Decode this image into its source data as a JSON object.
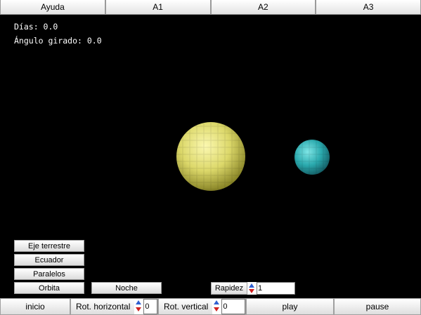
{
  "topbar": {
    "tabs": [
      "Ayuda",
      "A1",
      "A2",
      "A3"
    ]
  },
  "info": {
    "days": "Días: 0.0",
    "angle": "Ángulo girado: 0.0"
  },
  "panel": {
    "eje_label": "Eje terrestre",
    "ecuador_label": "Ecuador",
    "paralelos_label": "Paralelos",
    "orbita_label": "Orbita",
    "noche_label": "Noche"
  },
  "speed": {
    "label": "Rapidez",
    "value": "1"
  },
  "bottombar": {
    "inicio_label": "inicio",
    "rot_h_label": "Rot. horizontal",
    "rot_h_value": "0",
    "rot_v_label": "Rot. vertical",
    "rot_v_value": "0",
    "play_label": "play",
    "pause_label": "pause"
  },
  "colors": {
    "sun": "#e6e27a",
    "earth": "#2fb9b9",
    "background": "#000000"
  }
}
